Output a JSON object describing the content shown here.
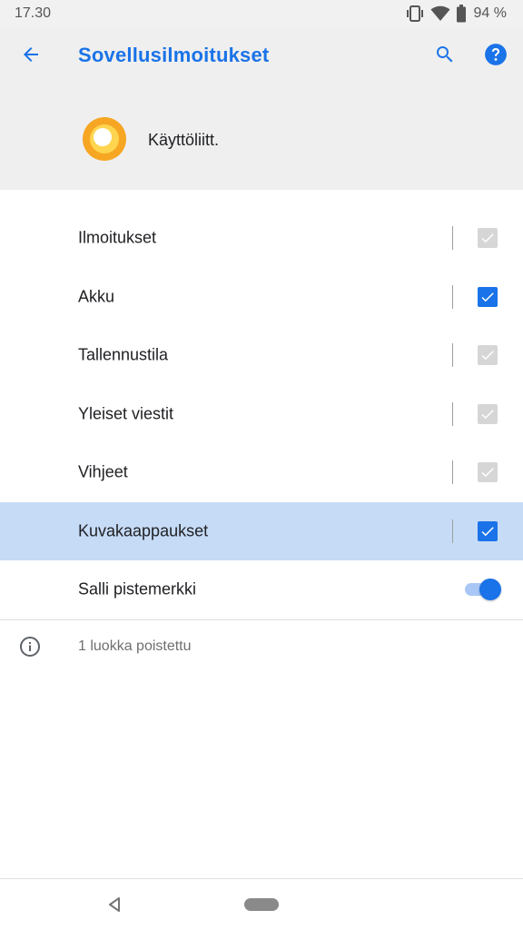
{
  "status_bar": {
    "time": "17.30",
    "battery_percent": "94 %",
    "icons": [
      "vibrate-icon",
      "wifi-icon",
      "battery-icon"
    ]
  },
  "header": {
    "title": "Sovellusilmoitukset",
    "back_icon": "arrow-left-icon",
    "search_icon": "search-icon",
    "help_icon": "help-icon",
    "app_name": "Käyttöliitt.",
    "accent_color": "#1a73e8"
  },
  "channels": [
    {
      "label": "Ilmoitukset",
      "checked": true,
      "enabled": false
    },
    {
      "label": "Akku",
      "checked": true,
      "enabled": true
    },
    {
      "label": "Tallennustila",
      "checked": true,
      "enabled": false
    },
    {
      "label": "Yleiset viestit",
      "checked": true,
      "enabled": false
    },
    {
      "label": "Vihjeet",
      "checked": true,
      "enabled": false
    },
    {
      "label": "Kuvakaappaukset",
      "checked": true,
      "enabled": true,
      "highlighted": true
    }
  ],
  "badge_setting": {
    "label": "Salli pistemerkki",
    "on": true
  },
  "footer": {
    "info_text": "1 luokka poistettu",
    "icon": "info-icon"
  },
  "nav_bar": {
    "back_icon": "nav-back-icon",
    "home_icon": "home-pill-icon"
  }
}
